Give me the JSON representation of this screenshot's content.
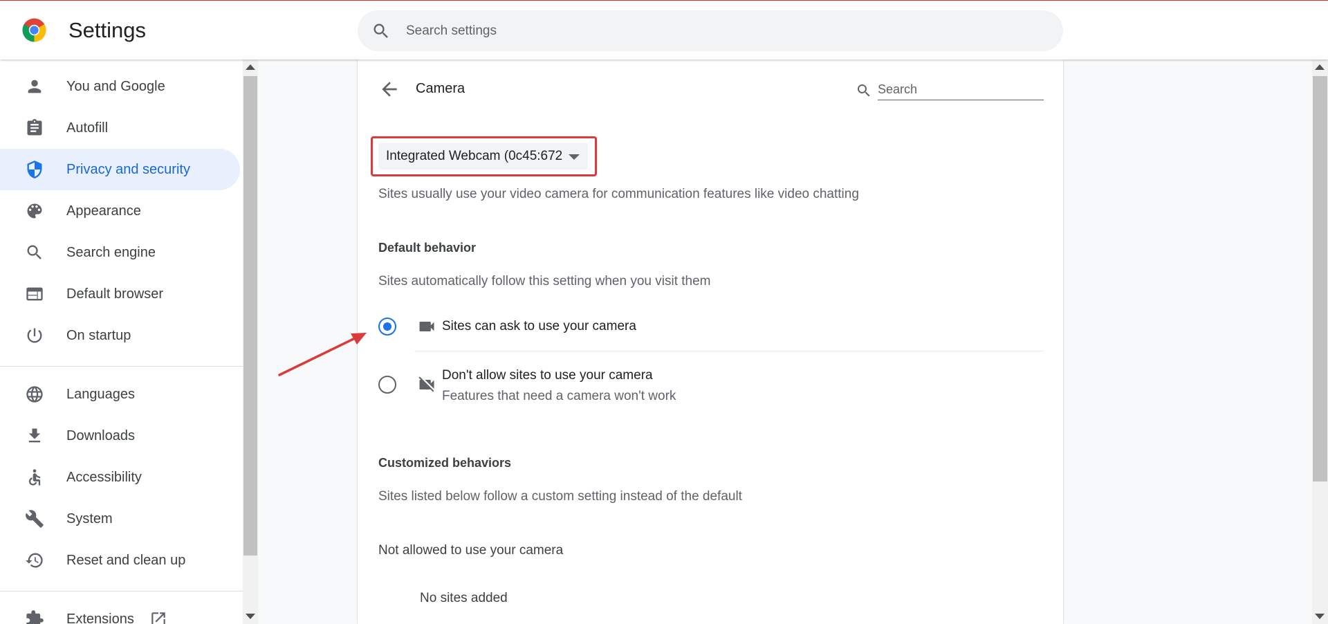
{
  "app": {
    "title": "Settings"
  },
  "search": {
    "placeholder": "Search settings"
  },
  "sidebar": {
    "items": [
      {
        "label": "You and Google",
        "icon": "person-icon"
      },
      {
        "label": "Autofill",
        "icon": "clipboard-icon"
      },
      {
        "label": "Privacy and security",
        "icon": "shield-icon",
        "active": true
      },
      {
        "label": "Appearance",
        "icon": "palette-icon"
      },
      {
        "label": "Search engine",
        "icon": "search-icon"
      },
      {
        "label": "Default browser",
        "icon": "browser-icon"
      },
      {
        "label": "On startup",
        "icon": "power-icon"
      },
      {
        "label": "Languages",
        "icon": "globe-icon"
      },
      {
        "label": "Downloads",
        "icon": "download-icon"
      },
      {
        "label": "Accessibility",
        "icon": "accessibility-icon"
      },
      {
        "label": "System",
        "icon": "wrench-icon"
      },
      {
        "label": "Reset and clean up",
        "icon": "restore-icon"
      },
      {
        "label": "Extensions",
        "icon": "puzzle-icon"
      }
    ]
  },
  "page": {
    "title": "Camera",
    "search_placeholder": "Search",
    "camera_device": "Integrated Webcam (0c45:672",
    "camera_description": "Sites usually use your video camera for communication features like video chatting",
    "default_behavior": {
      "heading": "Default behavior",
      "description": "Sites automatically follow this setting when you visit them",
      "options": [
        {
          "label": "Sites can ask to use your camera",
          "selected": true
        },
        {
          "label": "Don't allow sites to use your camera",
          "sublabel": "Features that need a camera won't work",
          "selected": false
        }
      ]
    },
    "customized": {
      "heading": "Customized behaviors",
      "description": "Sites listed below follow a custom setting instead of the default",
      "not_allowed_heading": "Not allowed to use your camera",
      "empty_text": "No sites added"
    }
  },
  "colors": {
    "accent": "#1a73e8",
    "highlight_box": "#d93a3a",
    "annotation_arrow": "#d93a3a",
    "active_bg": "#e8f0fe"
  }
}
